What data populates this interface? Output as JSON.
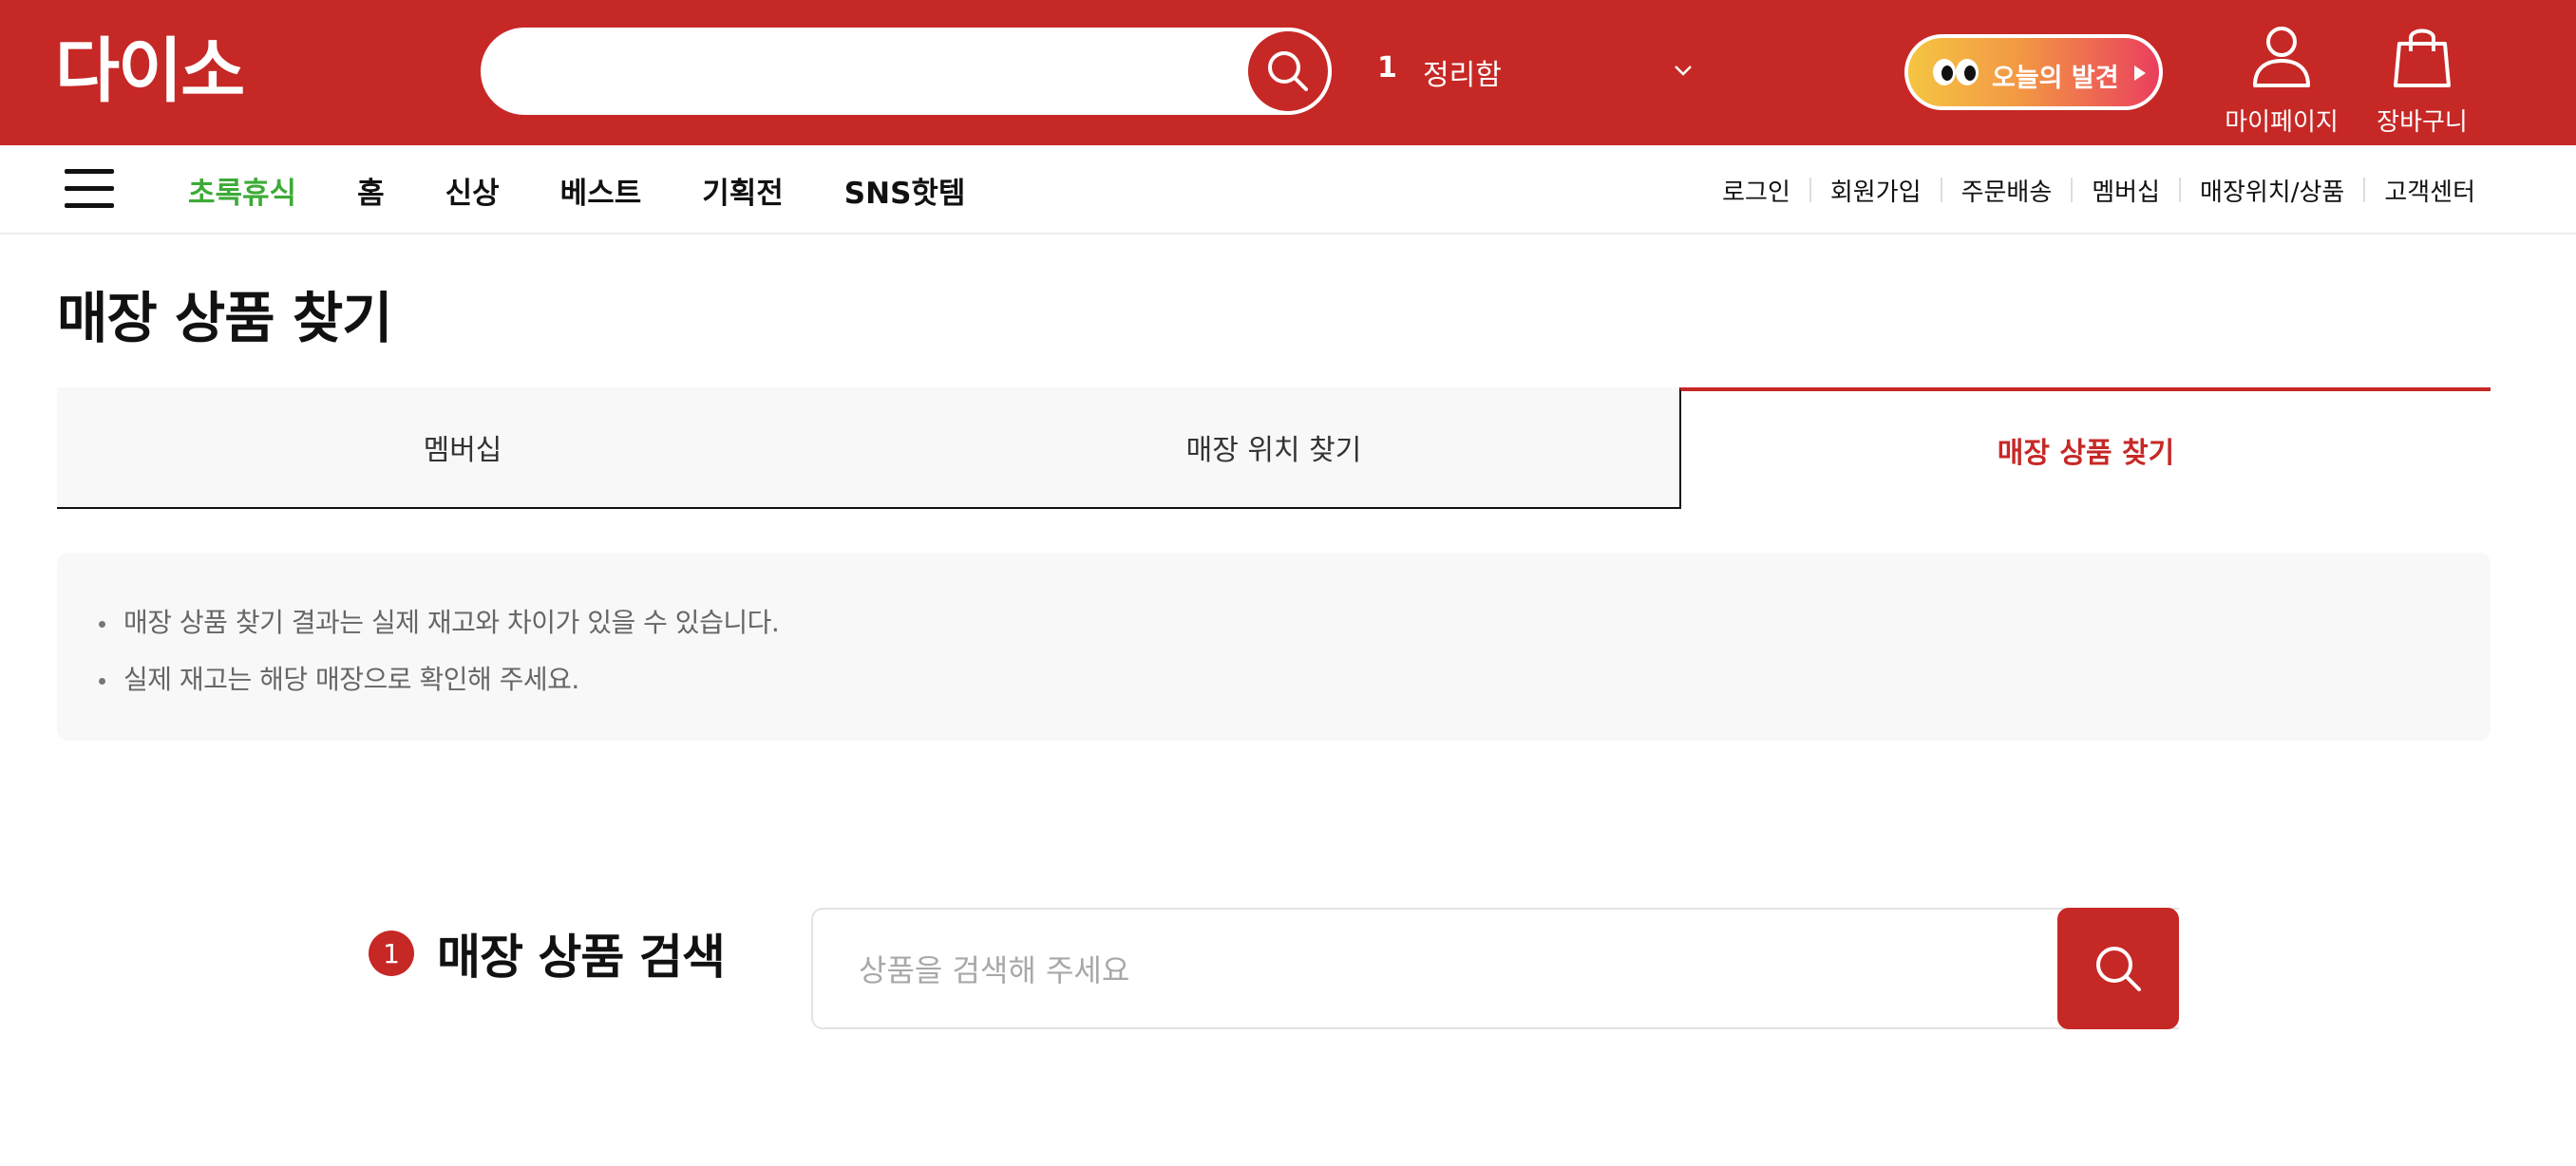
{
  "colors": {
    "brand_red": "#c62826",
    "accent_green": "#3dab37",
    "active_tab_text": "#c62826",
    "notice_bg": "#f8f8f8",
    "placeholder_gray": "#a8a8a8"
  },
  "header": {
    "logo_text": "다이소",
    "search": {
      "value": "",
      "placeholder": "",
      "button_icon": "search-icon"
    },
    "trending": {
      "rank": "1",
      "term": "정리함",
      "toggle_icon": "chevron-down-icon"
    },
    "discover_button": {
      "label": "오늘의 발견",
      "icon": "eyes-icon",
      "arrow_icon": "triangle-right-icon"
    },
    "mypage": {
      "label": "마이페이지",
      "icon": "user-icon"
    },
    "cart": {
      "label": "장바구니",
      "icon": "shopping-bag-icon"
    }
  },
  "nav": {
    "menu_icon": "hamburger-icon",
    "main_items": [
      {
        "label": "초록휴식",
        "highlight": true
      },
      {
        "label": "홈"
      },
      {
        "label": "신상"
      },
      {
        "label": "베스트"
      },
      {
        "label": "기획전"
      },
      {
        "label": "SNS핫템"
      }
    ],
    "utility_items": [
      {
        "label": "로그인"
      },
      {
        "label": "회원가입"
      },
      {
        "label": "주문배송"
      },
      {
        "label": "멤버십"
      },
      {
        "label": "매장위치/상품"
      },
      {
        "label": "고객센터"
      }
    ]
  },
  "page": {
    "title": "매장 상품 찾기",
    "tabs": [
      {
        "label": "멤버십",
        "active": false
      },
      {
        "label": "매장 위치 찾기",
        "active": false
      },
      {
        "label": "매장 상품 찾기",
        "active": true
      }
    ],
    "notices": [
      "매장 상품 찾기 결과는 실제 재고와 차이가 있을 수 있습니다.",
      "실제 재고는 해당 매장으로 확인해 주세요."
    ]
  },
  "product_search": {
    "step": "1",
    "title": "매장 상품 검색",
    "value": "",
    "placeholder": "상품을 검색해 주세요",
    "button_icon": "search-icon"
  }
}
